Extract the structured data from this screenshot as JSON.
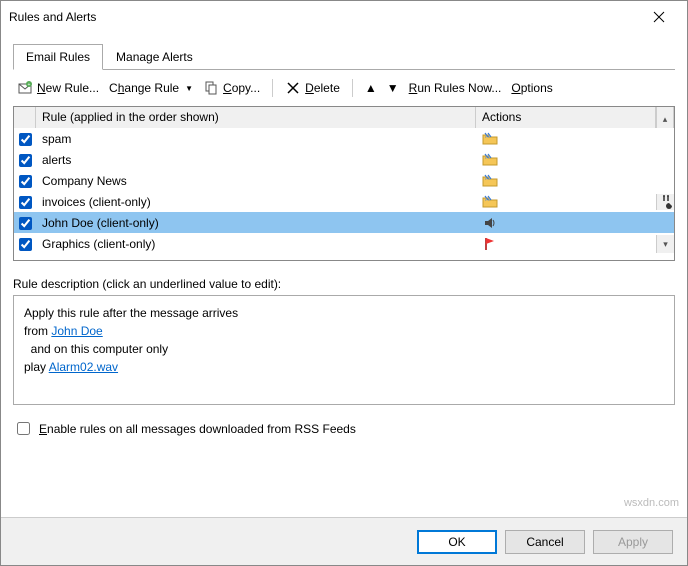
{
  "title": "Rules and Alerts",
  "tabs": {
    "email_rules": "Email Rules",
    "manage_alerts": "Manage Alerts"
  },
  "toolbar": {
    "new_rule": "New Rule...",
    "change_rule": "Change Rule",
    "copy": "Copy...",
    "delete": "Delete",
    "run_rules_now": "Run Rules Now...",
    "options": "Options"
  },
  "grid": {
    "col_rule": "Rule (applied in the order shown)",
    "col_actions": "Actions",
    "rows": [
      {
        "label": "spam",
        "action": "folder"
      },
      {
        "label": "alerts",
        "action": "folder"
      },
      {
        "label": "Company News",
        "action": "folder"
      },
      {
        "label": "invoices  (client-only)",
        "action": "folder",
        "extra": "wrench"
      },
      {
        "label": "John Doe  (client-only)",
        "action": "sound",
        "selected": true
      },
      {
        "label": "Graphics  (client-only)",
        "action": "flag"
      }
    ]
  },
  "description": {
    "label": "Rule description (click an underlined value to edit):",
    "line1": "Apply this rule after the message arrives",
    "line2_prefix": "from ",
    "line2_link": "John Doe",
    "line3": "  and on this computer only",
    "line4_prefix": "play ",
    "line4_link": "Alarm02.wav"
  },
  "rss_checkbox": "Enable rules on all messages downloaded from RSS Feeds",
  "buttons": {
    "ok": "OK",
    "cancel": "Cancel",
    "apply": "Apply"
  },
  "watermark": "wsxdn.com"
}
